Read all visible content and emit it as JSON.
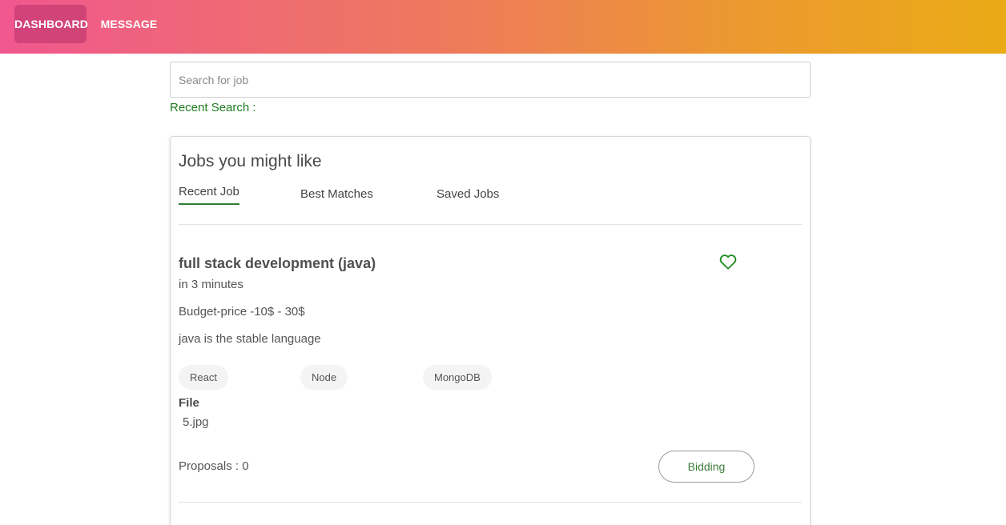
{
  "nav": {
    "dashboard_label": "DASHBOARD",
    "message_label": "MESSAGE"
  },
  "search": {
    "placeholder": "Search for job",
    "value": "",
    "recent_label": "Recent Search :"
  },
  "jobs_panel": {
    "title": "Jobs you might like",
    "tabs": [
      {
        "label": "Recent Job",
        "active": true
      },
      {
        "label": "Best Matches",
        "active": false
      },
      {
        "label": "Saved Jobs",
        "active": false
      }
    ]
  },
  "job": {
    "title": "full stack development (java)",
    "posted": "in 3 minutes",
    "budget": "Budget-price -10$ - 30$",
    "description": "java is the stable language",
    "skills": [
      "React",
      "Node",
      "MongoDB"
    ],
    "file_label": "File",
    "file_name": "5.jpg",
    "proposals": "Proposals : 0",
    "action_label": "Bidding",
    "save_icon": "heart-outline-icon"
  },
  "colors": {
    "header_gradient": [
      "#f0578f",
      "#ee7a5c",
      "#ec9a2e",
      "#eaab16"
    ],
    "accent_green": "#1f7d1f",
    "heart_color": "#1f8c1f"
  }
}
